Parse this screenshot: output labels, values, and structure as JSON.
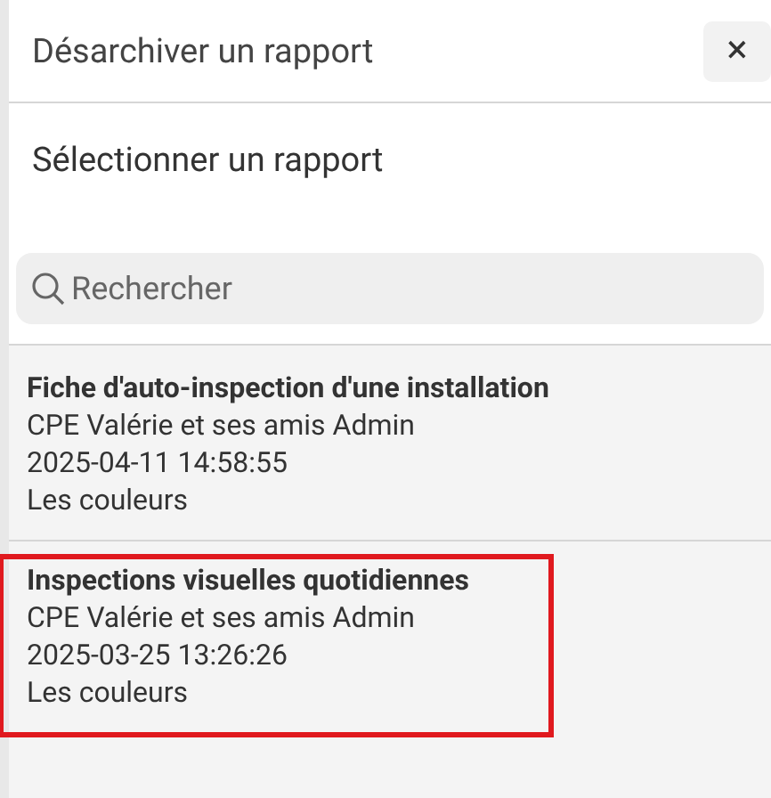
{
  "header": {
    "title": "Désarchiver un rapport",
    "close": "×"
  },
  "section_title": "Sélectionner un rapport",
  "search": {
    "placeholder": "Rechercher"
  },
  "reports": [
    {
      "title": "Fiche d'auto-inspection d'une installation",
      "author": "CPE Valérie et ses amis Admin",
      "date": "2025-04-11 14:58:55",
      "group": "Les couleurs",
      "highlighted": false
    },
    {
      "title": "Inspections visuelles quotidiennes",
      "author": "CPE Valérie et ses amis Admin",
      "date": "2025-03-25 13:26:26",
      "group": "Les couleurs",
      "highlighted": true
    }
  ]
}
